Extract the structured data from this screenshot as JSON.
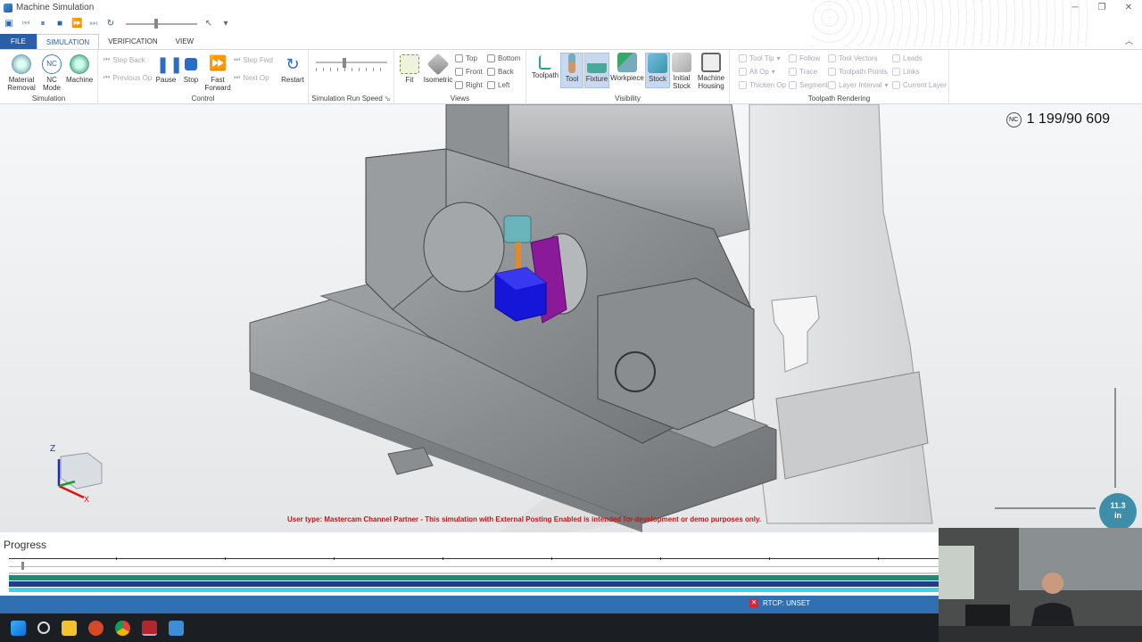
{
  "window": {
    "title": "Machine Simulation"
  },
  "quick_access": [
    "Save",
    "Previous",
    "Pause",
    "Stop",
    "Play",
    "Next",
    "Restart"
  ],
  "tabs": {
    "file": "FILE",
    "simulation": "SIMULATION",
    "verification": "VERIFICATION",
    "view": "VIEW"
  },
  "ribbon": {
    "simulation": {
      "label": "Simulation",
      "material_removal": "Material\nRemoval",
      "nc_mode": "NC\nMode",
      "machine": "Machine"
    },
    "control": {
      "label": "Control",
      "step_back": "Step Back",
      "previous_op": "Previous Op",
      "pause": "Pause",
      "stop": "Stop",
      "fast_forward": "Fast\nForward",
      "step_fwd": "Step Fwd",
      "next_op": "Next Op",
      "restart": "Restart"
    },
    "run_speed": {
      "label": "Simulation Run Speed"
    },
    "views": {
      "label": "Views",
      "fit": "Fit",
      "isometric": "Isometric",
      "top": "Top",
      "front": "Front",
      "right": "Right",
      "bottom": "Bottom",
      "back": "Back",
      "left": "Left"
    },
    "visibility": {
      "label": "Visibility",
      "toolpath": "Toolpath",
      "tool": "Tool",
      "fixture": "Fixture",
      "workpiece": "Workpiece",
      "stock": "Stock",
      "initial_stock": "Initial\nStock",
      "machine_housing": "Machine\nHousing"
    },
    "toolpath_rendering": {
      "label": "Toolpath Rendering",
      "tool_tip": "Tool Tip",
      "all_op": "All Op",
      "thicken_op": "Thicken Op",
      "follow": "Follow",
      "trace": "Trace",
      "segment": "Segment",
      "tool_vectors": "Tool Vectors",
      "toolpath_points": "Toolpath Points",
      "layer_interval": "Layer Interval",
      "leads": "Leads",
      "links": "Links",
      "current_layer": "Current Layer"
    }
  },
  "viewport": {
    "nc_badge": "NC",
    "nc_counter": "1 199/90 609",
    "warning": "User type: Mastercam Channel Partner - This simulation with External Posting Enabled is intended for development or demo purposes only.",
    "zoom_value": "11.3",
    "zoom_unit": "in",
    "axis_z": "Z",
    "axis_x": "X"
  },
  "progress": {
    "title": "Progress"
  },
  "status": {
    "rtcp": "RTCP: UNSET"
  },
  "colors": {
    "ribbon_accent": "#2a5ea6",
    "status_bar": "#2f6fb2",
    "band_dark": "#1f3d8c",
    "band_green": "#1f8a78",
    "band_cyan": "#3fd3ea",
    "stock": "#1616d8",
    "fixture": "#8a1a9a"
  }
}
